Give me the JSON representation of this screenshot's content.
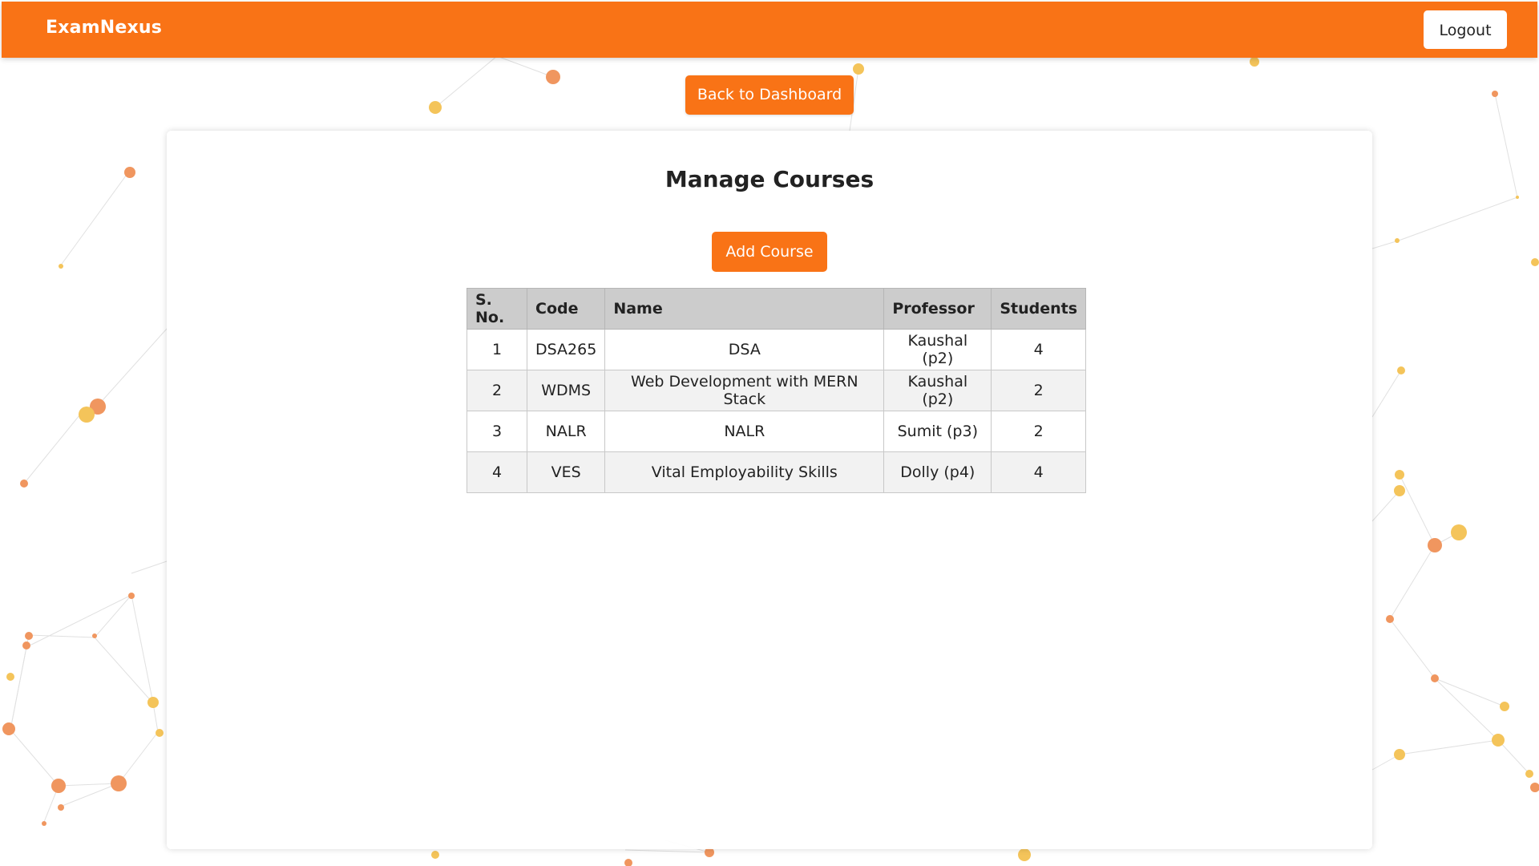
{
  "app": {
    "brand": "ExamNexus",
    "logout_label": "Logout"
  },
  "nav": {
    "back_label": "Back to Dashboard"
  },
  "main": {
    "title": "Manage Courses",
    "add_label": "Add Course"
  },
  "table": {
    "headers": [
      "S. No.",
      "Code",
      "Name",
      "Professor",
      "Students"
    ],
    "rows": [
      [
        "1",
        "DSA265",
        "DSA",
        "Kaushal (p2)",
        "4"
      ],
      [
        "2",
        "WDMS",
        "Web Development with MERN Stack",
        "Kaushal (p2)",
        "2"
      ],
      [
        "3",
        "NALR",
        "NALR",
        "Sumit (p3)",
        "2"
      ],
      [
        "4",
        "VES",
        "Vital Employability Skills",
        "Dolly (p4)",
        "4"
      ]
    ]
  },
  "colors": {
    "accent": "#f97316",
    "header_bg": "#cccccc",
    "row_alt_bg": "#f2f2f2"
  }
}
